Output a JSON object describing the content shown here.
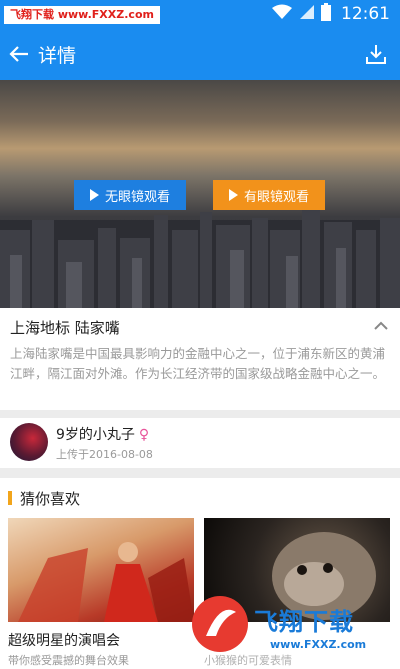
{
  "status_bar": {
    "watermark": "飞翔下载 www.FXXZ.com",
    "time": "12:61",
    "icons": [
      "wifi-icon",
      "signal-icon",
      "battery-icon"
    ]
  },
  "app_bar": {
    "title": "详情",
    "back_icon": "arrow-left-icon",
    "download_icon": "download-icon"
  },
  "hero": {
    "btn_noglasses": "无眼镜观看",
    "btn_glasses": "有眼镜观看"
  },
  "description": {
    "title": "上海地标 陆家嘴",
    "text": "上海陆家嘴是中国最具影响力的金融中心之一，位于浦东新区的黄浦江畔，隔江面对外滩。作为长江经济带的国家级战略金融中心之一。"
  },
  "author": {
    "name": "9岁的小丸子",
    "gender_symbol": "♀",
    "uploaded": "上传于2016-08-08"
  },
  "recommend": {
    "title": "猜你喜欢",
    "cards": [
      {
        "title": "超级明星的演唱会",
        "subtitle": "带你感受震撼的舞台效果"
      },
      {
        "subtitle": "小猴猴的可爱表情"
      }
    ]
  },
  "watermark_bottom": {
    "brand": "飞翔下载",
    "url": "www.FXXZ.com"
  },
  "colors": {
    "primary": "#1a8cf0",
    "blue_button": "#1e7fe0",
    "orange_button": "#f2921b",
    "accent_bar": "#f2a51b"
  }
}
